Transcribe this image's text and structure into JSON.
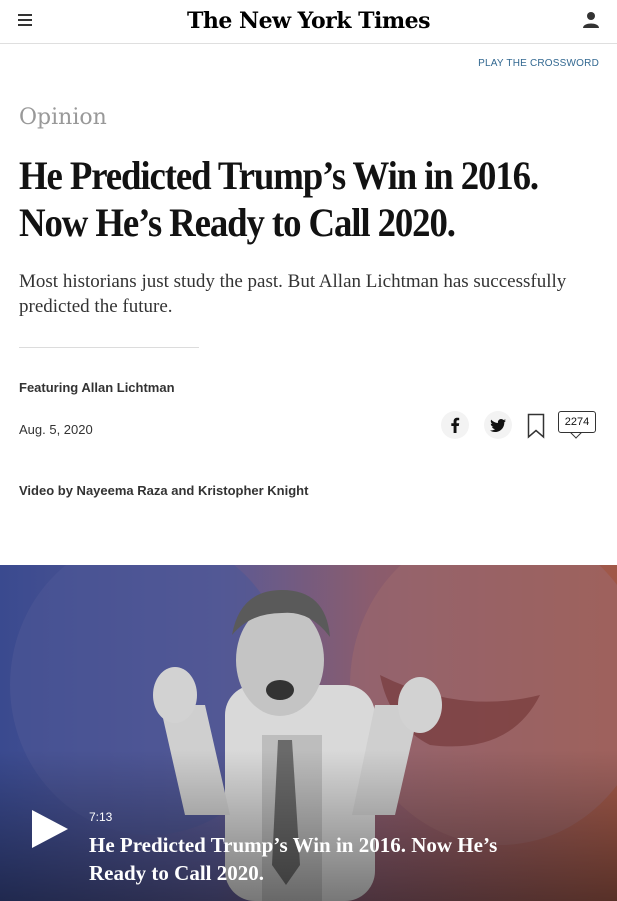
{
  "header": {
    "logo": "The New York Times",
    "menu_icon": "hamburger-icon",
    "account_icon": "account-icon"
  },
  "crossword_link": "PLAY THE CROSSWORD",
  "article": {
    "kicker": "Opinion",
    "headline": "He Predicted Trump’s Win in 2016. Now He’s Ready to Call 2020.",
    "summary": "Most historians just study the past. But Allan Lichtman has successfully predicted the future.",
    "featuring": "Featuring Allan Lichtman",
    "date": "Aug. 5, 2020",
    "byline": "Video by Nayeema Raza and Kristopher Knight"
  },
  "share": {
    "facebook_icon": "facebook-icon",
    "twitter_icon": "twitter-icon",
    "bookmark_icon": "bookmark-icon",
    "comment_count": "2274"
  },
  "video": {
    "duration": "7:13",
    "title": "He Predicted Trump’s Win in 2016. Now He’s Ready to Call 2020.",
    "play_icon": "play-icon"
  },
  "colors": {
    "link": "#326891",
    "kicker": "#999999",
    "text": "#121212"
  }
}
